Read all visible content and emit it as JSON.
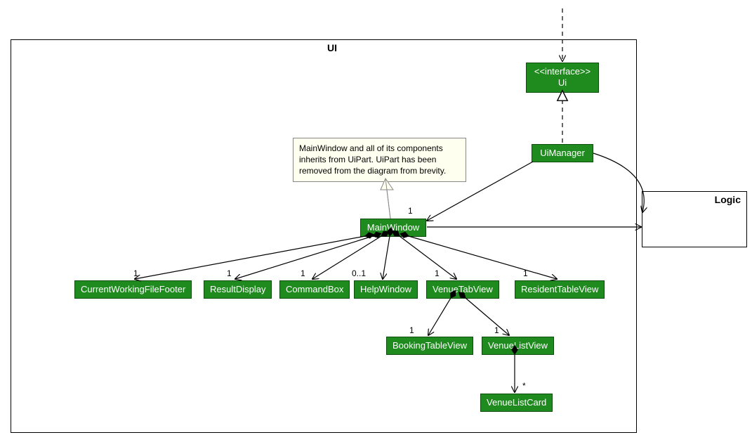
{
  "diagram": {
    "packages": {
      "ui": {
        "label": "UI"
      },
      "logic": {
        "label": "Logic"
      }
    },
    "classes": {
      "uiInterface": {
        "stereotype": "<<interface>>",
        "name": "Ui"
      },
      "uiManager": {
        "name": "UiManager"
      },
      "mainWindow": {
        "name": "MainWindow"
      },
      "currentWorkingFileFooter": {
        "name": "CurrentWorkingFileFooter"
      },
      "resultDisplay": {
        "name": "ResultDisplay"
      },
      "commandBox": {
        "name": "CommandBox"
      },
      "helpWindow": {
        "name": "HelpWindow"
      },
      "venueTabView": {
        "name": "VenueTabView"
      },
      "residentTableView": {
        "name": "ResidentTableView"
      },
      "bookingTableView": {
        "name": "BookingTableView"
      },
      "venueListView": {
        "name": "VenueListView"
      },
      "venueListCard": {
        "name": "VenueListCard"
      }
    },
    "note": {
      "line1": "MainWindow and all of its components",
      "line2": "inherits from UiPart. UiPart has been",
      "line3": "removed from the diagram from brevity."
    },
    "multiplicities": {
      "mw_uiManager": "1",
      "mw_cwff": "1",
      "mw_resultDisplay": "1",
      "mw_commandBox": "1",
      "mw_helpWindow": "0..1",
      "mw_venueTabView": "1",
      "mw_residentTableView": "1",
      "vtv_bookingTableView": "1",
      "vtv_venueListView": "1",
      "vlv_venueListCard": "*"
    }
  }
}
